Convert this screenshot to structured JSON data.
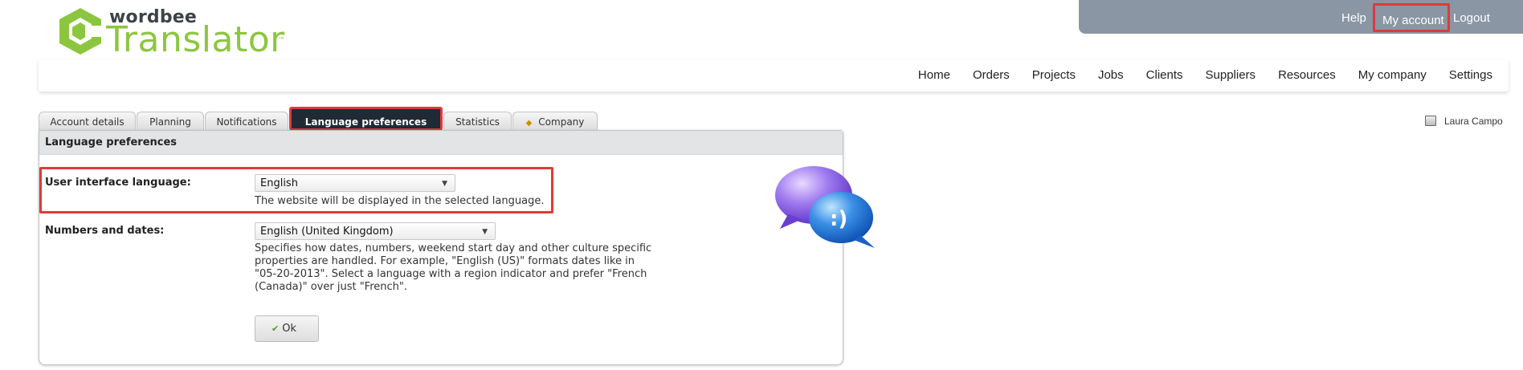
{
  "logo": {
    "small_text": "wordbee",
    "big_text": "Translator",
    "tm": "™"
  },
  "topbar": {
    "help": "Help",
    "my_account": "My account",
    "logout": "Logout"
  },
  "mainnav": [
    "Home",
    "Orders",
    "Projects",
    "Jobs",
    "Clients",
    "Suppliers",
    "Resources",
    "My company",
    "Settings"
  ],
  "user": {
    "name": "Laura Campo",
    "icon": "user-card-icon"
  },
  "tabs": [
    {
      "label": "Account details",
      "active": false
    },
    {
      "label": "Planning",
      "active": false
    },
    {
      "label": "Notifications",
      "active": false
    },
    {
      "label": "Language preferences",
      "active": true
    },
    {
      "label": "Statistics",
      "active": false
    },
    {
      "label": "Company",
      "active": false,
      "icon": "star-icon"
    }
  ],
  "panel": {
    "title": "Language preferences",
    "ui_language": {
      "label": "User interface language:",
      "value": "English",
      "help": "The website will be displayed in the selected language."
    },
    "numbers_dates": {
      "label": "Numbers and dates:",
      "value": "English (United Kingdom)",
      "help_lines": [
        "Specifies how dates, numbers, weekend start day and other culture specific",
        "properties are handled. For example, \"English (US)\" formats dates like in",
        "\"05-20-2013\". Select a language with a region indicator and prefer \"French",
        "(Canada)\" over just \"French\"."
      ]
    },
    "ok_label": "Ok",
    "bubble_text": ":)"
  },
  "colors": {
    "brand_green": "#8cc63f",
    "topbar": "#8a96a3",
    "highlight": "#e0393b",
    "active_tab": "#1f2a34"
  }
}
